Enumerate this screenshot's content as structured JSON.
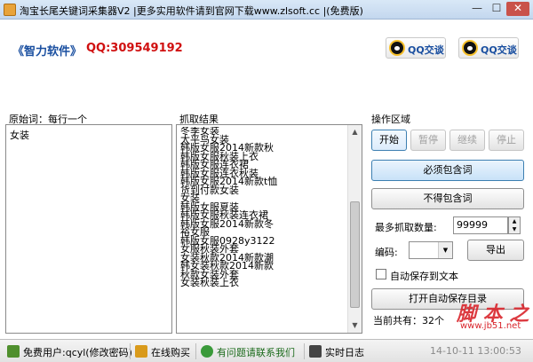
{
  "window": {
    "title": "淘宝长尾关键词采集器V2  |更多实用软件请到官网下载www.zlsoft.cc  |(免费版)",
    "min": "—",
    "max": "☐",
    "close": "✕"
  },
  "header": {
    "brand": "《智力软件》",
    "qq_label": "QQ:309549192",
    "qq_button_1": "QQ交谈",
    "qq_button_2": "QQ交谈"
  },
  "left_panel": {
    "label": "原始词：每行一个",
    "content": "女装"
  },
  "middle_panel": {
    "label": "抓取结果",
    "results": [
      "冬季女装",
      "太平鸟女装",
      "韩版女服2014新款秋",
      "韩版女服秋装上衣",
      "韩版女服连衣裙",
      "韩版女服连衣秋装",
      "韩版女服2014新款t恤",
      "货到付款女装",
      "女装",
      "韩版女服夏装",
      "韩版女服秋装连衣裙",
      "韩版女服2014新款冬",
      "裕女服",
      "韩版女服0928y3122",
      "女服秋装外套",
      "女装秋款2014新款潮",
      "韩女装秋款2014新款",
      "秋款女装外套",
      "女装秋装上衣"
    ]
  },
  "ops": {
    "label": "操作区域",
    "start": "开始",
    "pause": "暂停",
    "resume": "继续",
    "stop": "停止",
    "must_include": "必须包含词",
    "must_exclude": "不得包含词",
    "max_count_label": "最多抓取数量:",
    "max_count_value": "99999",
    "encoding_label": "编码:",
    "encoding_value": "",
    "export": "导出",
    "auto_save_label": "自动保存到文本",
    "open_folder": "打开自动保存目录",
    "current_total": "当前共有：32个"
  },
  "watermark": {
    "main": "脚 本 之 家",
    "sub": "www.jb51.net"
  },
  "statusbar": {
    "user": "免费用户:qcyl(修改密码)",
    "buy": "在线购买",
    "contact": "有问题请联系我们",
    "log": "实时日志",
    "datetime": "14-10-11 13:00:53"
  }
}
